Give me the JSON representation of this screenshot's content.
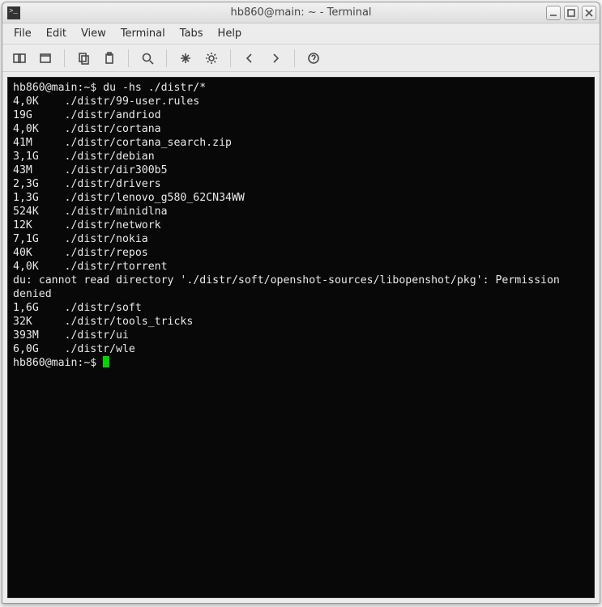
{
  "window": {
    "title": "hb860@main: ~ - Terminal"
  },
  "menu": {
    "file": "File",
    "edit": "Edit",
    "view": "View",
    "terminal": "Terminal",
    "tabs": "Tabs",
    "help": "Help"
  },
  "terminal": {
    "prompt1": "hb860@main:~$ ",
    "command": "du -hs ./distr/*",
    "error": "du: cannot read directory './distr/soft/openshot-sources/libopenshot/pkg': Permission denied",
    "prompt2": "hb860@main:~$ ",
    "entries_top": [
      {
        "size": "4,0K",
        "path": "./distr/99-user.rules"
      },
      {
        "size": "19G",
        "path": "./distr/andriod"
      },
      {
        "size": "4,0K",
        "path": "./distr/cortana"
      },
      {
        "size": "41M",
        "path": "./distr/cortana_search.zip"
      },
      {
        "size": "3,1G",
        "path": "./distr/debian"
      },
      {
        "size": "43M",
        "path": "./distr/dir300b5"
      },
      {
        "size": "2,3G",
        "path": "./distr/drivers"
      },
      {
        "size": "1,3G",
        "path": "./distr/lenovo_g580_62CN34WW"
      },
      {
        "size": "524K",
        "path": "./distr/minidlna"
      },
      {
        "size": "12K",
        "path": "./distr/network"
      },
      {
        "size": "7,1G",
        "path": "./distr/nokia"
      },
      {
        "size": "40K",
        "path": "./distr/repos"
      },
      {
        "size": "4,0K",
        "path": "./distr/rtorrent"
      }
    ],
    "entries_bottom": [
      {
        "size": "1,6G",
        "path": "./distr/soft"
      },
      {
        "size": "32K",
        "path": "./distr/tools_tricks"
      },
      {
        "size": "393M",
        "path": "./distr/ui"
      },
      {
        "size": "6,0G",
        "path": "./distr/wle"
      }
    ]
  }
}
